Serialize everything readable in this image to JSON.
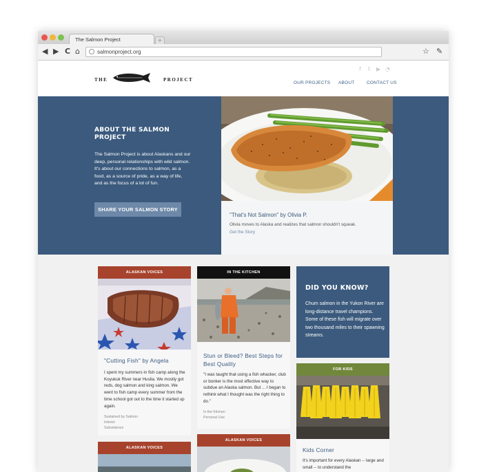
{
  "browser": {
    "tab_title": "The Salmon Project",
    "new_tab": "+",
    "back": "◀",
    "forward": "▶",
    "reload": "C",
    "home": "⌂",
    "url": "salmonproject.org",
    "star": "☆",
    "wrench": "✎",
    "lights": {
      "red": "#e9574f",
      "yellow": "#f0b73a",
      "green": "#7dc24f"
    }
  },
  "header": {
    "logo_left": "THE",
    "logo_right": "PROJECT",
    "social": {
      "facebook": "f",
      "twitter": "t",
      "youtube": "▶",
      "rss": "◔"
    },
    "nav": [
      "OUR PROJECTS",
      "ABOUT",
      "CONTACT US"
    ]
  },
  "hero": {
    "title": "ABOUT THE SALMON PROJECT",
    "body": "The Salmon Project is about Alaskans and our deep, personal relationships with wild salmon. It's about our connections to salmon, as a food, as a source of pride, as a way of life, and as the focus of a lot of fun.",
    "button": "SHARE YOUR SALMON STORY",
    "feature": {
      "title": "\"That's Not Salmon\" by Olivia P.",
      "description": "Olivia moves to Alaska and realizes that salmon shouldn't squeak.",
      "link": "Get the Story"
    }
  },
  "cards": {
    "voices": {
      "label": "ALASKAN VOICES",
      "title": "\"Cutting Fish\" by Angela",
      "excerpt": "I spent my summers in fish camp along the Koyukuk River near Huslia. We mostly got reds, dog salmon and king salmon. We went to fish camp every summer from the time school got out to the time it started up again.",
      "meta": [
        "Sustained by Salmon",
        "Interior",
        "Subsistence"
      ]
    },
    "kitchen": {
      "label": "IN THE KITCHEN",
      "title": "Stun or Bleed? Best Steps for Best Quality",
      "excerpt": "\"I was taught that using a fish whacker, club or bonker is the most effective way to subdue an Alaska salmon. But ... I began to rethink what I thought was the right thing to do.\"",
      "meta": [
        "In the Kitchen",
        "Personal Use"
      ]
    },
    "did_you_know": {
      "title": "DID YOU KNOW?",
      "body": "Chum salmon in the Yukon River are long-distance travel champions. Some of these fish will migrate over two thousand miles to their spawning streams."
    },
    "kids": {
      "label": "FOR KIDS",
      "title": "Kids Corner",
      "excerpt": "It's important for every Alaskan -- large and small -- to understand the"
    },
    "voices2": {
      "label": "ALASKAN VOICES"
    },
    "voices3": {
      "label": "ALASKAN VOICES"
    }
  },
  "colors": {
    "brand_blue": "#3b5a7d",
    "button_blue": "#6d88a8",
    "label_red": "#a7432d",
    "label_black": "#111111",
    "label_green": "#71873b"
  }
}
